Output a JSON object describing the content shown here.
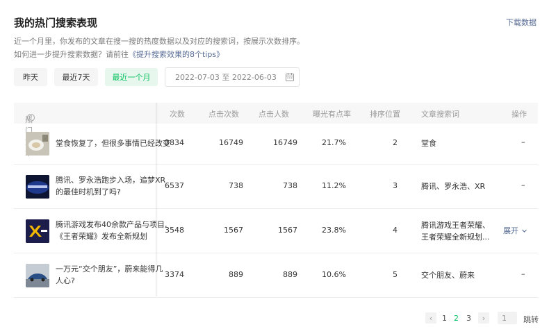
{
  "header": {
    "title": "我的热门搜索表现",
    "download": "下载数据",
    "desc_line1": "近一个月里，你发布的文章在搜一搜的热度数据以及对应的搜索词，按展示次数排序。",
    "desc_line2_prefix": "如何进一步提升搜索数据？请前往",
    "desc_line2_link": "《提升搜索效果的8个tips》"
  },
  "filters": {
    "yesterday": "昨天",
    "last7": "最近7天",
    "last_month": "最近一个月",
    "date_range": "2022-07-03 至 2022-06-03",
    "active": "last_month"
  },
  "table": {
    "headers": {
      "article": "热门文章",
      "views": "次数",
      "clicks": "点击次数",
      "clickers": "点击人数",
      "ctr": "曝光有点率",
      "rank": "排序位置",
      "keywords": "文章搜索词",
      "action": "操作"
    },
    "rows": [
      {
        "title": "堂食恢复了，但很多事情已经改变",
        "views": "3834",
        "clicks": "16749",
        "clickers": "16749",
        "ctr": "21.7%",
        "rank": "2",
        "keywords": "堂食",
        "keywords2": "",
        "action": "–"
      },
      {
        "title": "腾讯、罗永浩跑步入场，追梦XR的最佳时机到了吗?",
        "views": "6537",
        "clicks": "738",
        "clickers": "738",
        "ctr": "11.2%",
        "rank": "3",
        "keywords": "腾讯、罗永浩、XR",
        "keywords2": "",
        "action": "–"
      },
      {
        "title": "腾讯游戏发布40余款产品与项目,《王者荣耀》发布全新规划",
        "views": "3548",
        "clicks": "1567",
        "clickers": "1567",
        "ctr": "23.8%",
        "rank": "4",
        "keywords": "腾讯游戏王者荣耀、",
        "keywords2": "王者荣耀全新规划...",
        "action": "展开"
      },
      {
        "title": "一万元“交个朋友”，蔚来能得几人心?",
        "views": "3374",
        "clicks": "889",
        "clickers": "889",
        "ctr": "10.6%",
        "rank": "5",
        "keywords": "交个朋友、蔚来",
        "keywords2": "",
        "action": "–"
      }
    ]
  },
  "pagination": {
    "prev": "‹",
    "pages": [
      "1",
      "2",
      "3"
    ],
    "current": "2",
    "next": "›",
    "input_value": "1",
    "jump": "跳转"
  },
  "colors": {
    "accent_green": "#07c160",
    "link_blue": "#576b95"
  }
}
